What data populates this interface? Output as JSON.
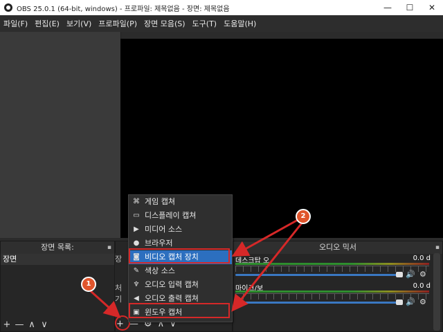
{
  "window": {
    "title": "OBS 25.0.1 (64-bit, windows) - 프로파일: 제목없음 - 장면: 제목없음",
    "minimize": "—",
    "maximize": "☐",
    "close": "✕"
  },
  "menubar": [
    "파일(F)",
    "편집(E)",
    "보기(V)",
    "프로파일(P)",
    "장면 모음(S)",
    "도구(T)",
    "도움말(H)"
  ],
  "scenes_dock": {
    "title": "장면 목록:",
    "items": [
      "장면"
    ],
    "toolbar": [
      "+",
      "—",
      "∧",
      "∨"
    ]
  },
  "sources_dock": {
    "partial_text_1": "장",
    "partial_text_2": "처기"
  },
  "source_toolbar": [
    "+",
    "—",
    "⚙",
    "∧",
    "∨"
  ],
  "mixer": {
    "title": "오디오 믹서",
    "tracks": [
      {
        "name": "데스크탑 오",
        "db": "0.0 d"
      },
      {
        "name": "마이크/보",
        "db": "0.0 d"
      }
    ]
  },
  "add_source_menu": {
    "items": [
      {
        "label": "게임 캡쳐",
        "icon": "gamepad-icon"
      },
      {
        "label": "디스플레이 캡쳐",
        "icon": "monitor-icon"
      },
      {
        "label": "미디어 소스",
        "icon": "play-icon"
      },
      {
        "label": "브라우저",
        "icon": "globe-icon"
      },
      {
        "label": "비디오 캡처 장치",
        "icon": "camera-icon",
        "selected": true
      },
      {
        "label": "색상 소스",
        "icon": "brush-icon"
      },
      {
        "label": "오디오 입력 캡쳐",
        "icon": "microphone-icon"
      },
      {
        "label": "오디오 출력 캡쳐",
        "icon": "speaker-icon"
      },
      {
        "label": "윈도우 캡처",
        "icon": "window-icon"
      }
    ]
  },
  "annotations": {
    "badge_1": "1",
    "badge_2": "2",
    "highlight_color": "#d62828",
    "badge_color": "#e0552c"
  }
}
